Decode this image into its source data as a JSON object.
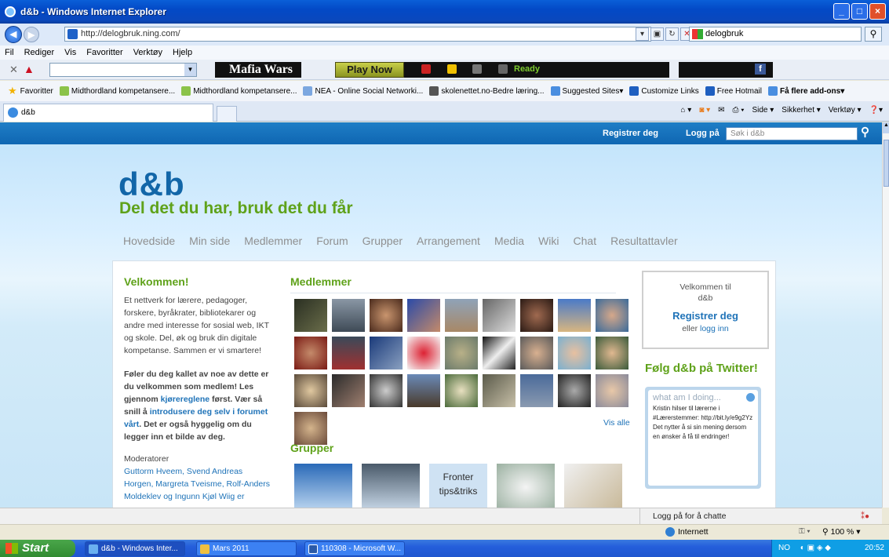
{
  "window": {
    "title": "d&b - Windows Internet Explorer"
  },
  "address_bar": {
    "url": "http://delogbruk.ning.com/",
    "search_value": "delogbruk"
  },
  "menu": [
    "Fil",
    "Rediger",
    "Vis",
    "Favoritter",
    "Verktøy",
    "Hjelp"
  ],
  "toolbar": {
    "mafia_wars": "Mafia Wars",
    "play_now": "Play Now",
    "status": "Ready"
  },
  "favorites": {
    "label": "Favoritter",
    "items": [
      "Midthordland kompetansere...",
      "Midthordland kompetansere...",
      "NEA - Online Social Networki...",
      "skolenettet.no-Bedre læring...",
      "Suggested Sites",
      "Customize Links",
      "Free Hotmail",
      "Få flere add-ons"
    ]
  },
  "tab": {
    "label": "d&b"
  },
  "command_bar": [
    "Side",
    "Sikkerhet",
    "Verktøy"
  ],
  "site": {
    "header": {
      "register": "Registrer deg",
      "login": "Logg på",
      "search_placeholder": "Søk i d&b"
    },
    "logo": "d&b",
    "tagline": "Del det du har, bruk det du får",
    "nav": [
      "Hovedside",
      "Min side",
      "Medlemmer",
      "Forum",
      "Grupper",
      "Arrangement",
      "Media",
      "Wiki",
      "Chat",
      "Resultattavler"
    ],
    "welcome": {
      "heading": "Velkommen!",
      "intro": "Et nettverk for lærere, pedagoger, forskere, byråkrater, bibliotekarer og andre med interesse for sosial web, IKT og skole. Del, øk og bruk din digitale kompetanse. Sammen er vi smartere!",
      "bold_1": "Føler du deg kallet av noe av dette er du velkommen som medlem! Les gjennom ",
      "link_1": "kjørereglene",
      "bold_2": " først. Vær så snill å ",
      "link_2": "introdusere deg selv i forumet vårt",
      "bold_3": ". Det er også hyggelig om du legger inn et bilde av deg.",
      "moderators_heading": "Moderatorer",
      "moderators": "Guttorm Hveem, Svend Andreas Horgen, Margreta Tveisme, Rolf-Anders Moldeklev og Ingunn Kjøl Wiig er"
    },
    "members": {
      "heading": "Medlemmer",
      "see_all": "Vis alle"
    },
    "groups": {
      "heading": "Grupper",
      "fronter_label": "Fronter tips&triks"
    },
    "sidebar": {
      "welcome_line1": "Velkommen til",
      "welcome_line2": "d&b",
      "register": "Registrer deg",
      "or": "eller ",
      "login": "logg inn",
      "twitter_heading": "Følg d&b på Twitter!",
      "tw_label": "what am I doing...",
      "tw_message": "Kristin hilser til lærerne i #Lærerstemmer: http://bit.ly/e9g2Yz Det nytter å si sin mening dersom en ønsker å få til endringer!"
    }
  },
  "chat": {
    "label": "Logg på for å chatte"
  },
  "status": {
    "zone": "Internett",
    "zoom": "100 %"
  },
  "taskbar": {
    "start": "Start",
    "items": [
      "d&b - Windows Inter...",
      "Mars 2011",
      "110308 - Microsoft W..."
    ],
    "lang": "NO",
    "clock": "20:52"
  },
  "colors": {
    "brand_blue": "#1266a8",
    "brand_green": "#5fa21a",
    "link": "#1f73b8"
  }
}
